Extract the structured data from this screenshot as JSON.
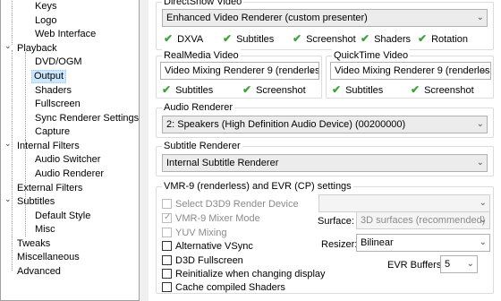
{
  "tree": {
    "keys": "Keys",
    "logo": "Logo",
    "web_interface": "Web Interface",
    "playback": "Playback",
    "dvd_ogm": "DVD/OGM",
    "output": "Output",
    "shaders": "Shaders",
    "fullscreen": "Fullscreen",
    "sync_renderer": "Sync Renderer Settings",
    "capture": "Capture",
    "internal_filters": "Internal Filters",
    "audio_switcher": "Audio Switcher",
    "audio_renderer": "Audio Renderer",
    "external_filters": "External Filters",
    "subtitles": "Subtitles",
    "default_style": "Default Style",
    "misc": "Misc",
    "tweaks": "Tweaks",
    "miscellaneous": "Miscellaneous",
    "advanced": "Advanced"
  },
  "directshow": {
    "title": "DirectShow Video",
    "renderer": "Enhanced Video Renderer (custom presenter)",
    "caps": [
      "DXVA",
      "Subtitles",
      "Screenshot",
      "Shaders",
      "Rotation"
    ]
  },
  "realmedia": {
    "title": "RealMedia Video",
    "renderer": "Video Mixing Renderer 9 (renderless",
    "caps": [
      "Subtitles",
      "Screenshot"
    ]
  },
  "quicktime": {
    "title": "QuickTime Video",
    "renderer": "Video Mixing Renderer 9 (renderless",
    "caps": [
      "Subtitles",
      "Screenshot"
    ]
  },
  "audio": {
    "title": "Audio Renderer",
    "renderer": "2: Speakers (High Definition Audio Device) (00200000)"
  },
  "subtitle": {
    "title": "Subtitle Renderer",
    "renderer": "Internal Subtitle Renderer"
  },
  "vmr": {
    "title": "VMR-9 (renderless) and EVR (CP) settings",
    "select_d3d9": "Select D3D9 Render Device",
    "device": "",
    "mixer_mode": "VMR-9 Mixer Mode",
    "yuv_mixing": "YUV Mixing",
    "alt_vsync": "Alternative VSync",
    "d3d_fullscreen": "D3D Fullscreen",
    "reinit": "Reinitialize when changing display",
    "cache_shaders": "Cache compiled Shaders",
    "surface_label": "Surface:",
    "surface_value": "3D surfaces (recommended)",
    "resizer_label": "Resizer:",
    "resizer_value": "Bilinear",
    "evr_label": "EVR Buffers:",
    "evr_value": "5"
  },
  "colors": {
    "check": "#3fa33a",
    "selection": "#cce8ff"
  }
}
